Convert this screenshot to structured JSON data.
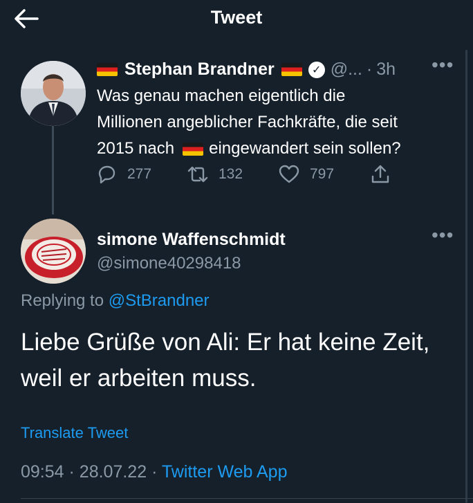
{
  "header": {
    "title": "Tweet"
  },
  "parent_tweet": {
    "name": "Stephan Brandner",
    "handle": "@...",
    "separator": "·",
    "time": "3h",
    "text_line1": "Was genau machen eigentlich die",
    "text_line2": "Millionen angeblicher Fachkräfte, die seit",
    "text_line3_a": "2015 nach",
    "text_line3_b": "eingewandert sein sollen?",
    "replies": "277",
    "retweets": "132",
    "likes": "797",
    "more_label": "•••"
  },
  "reply_tweet": {
    "name": "simone Waffenschmidt",
    "handle": "@simone40298418",
    "more_label": "•••",
    "replying_to_label": "Replying to",
    "replying_to_handle": "@StBrandner",
    "text": "Liebe Grüße von Ali: Er hat keine Zeit, weil er arbeiten muss.",
    "translate_label": "Translate Tweet",
    "time": "09:54",
    "date": "28.07.22",
    "separator": "·",
    "source": "Twitter Web App"
  },
  "icons": [
    "back-arrow-icon",
    "verified-icon",
    "reply-icon",
    "retweet-icon",
    "like-icon",
    "share-icon",
    "more-icon",
    "flag-germany-icon"
  ],
  "colors": {
    "background": "#15202b",
    "accent": "#1d9bf0",
    "secondary_text": "#8b98a5"
  }
}
